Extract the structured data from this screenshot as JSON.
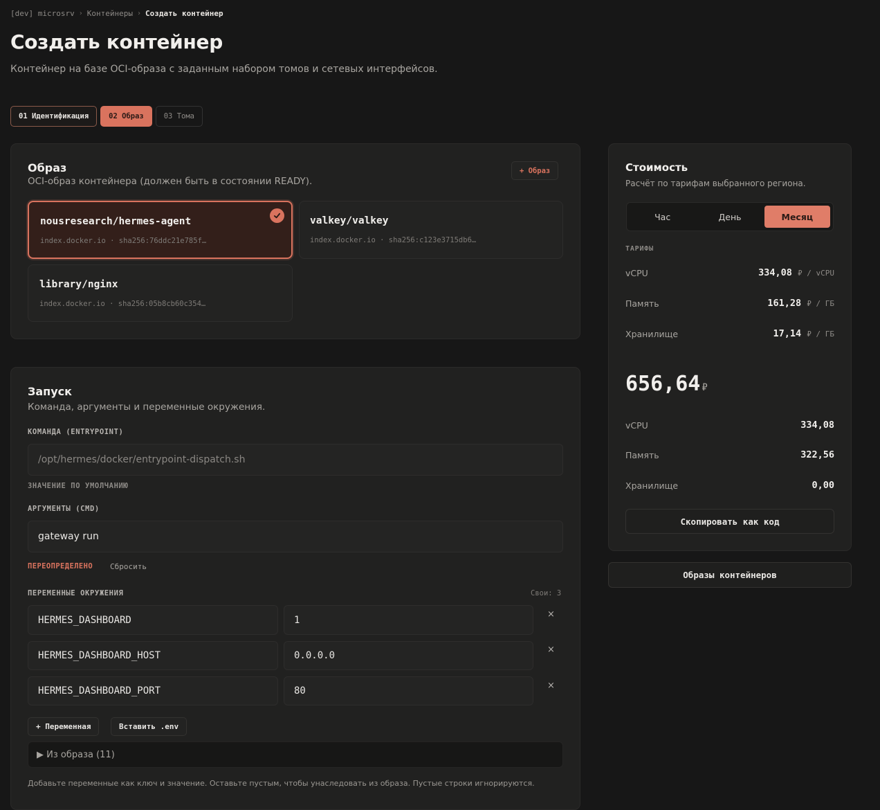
{
  "breadcrumb": {
    "project": "[dev] microsrv",
    "section": "Контейнеры",
    "current": "Создать контейнер"
  },
  "page": {
    "title": "Создать контейнер",
    "subtitle": "Контейнер на базе OCI-образа с заданным набором томов и сетевых интерфейсов."
  },
  "steps": [
    {
      "label": "01 Идентификация",
      "state": "done"
    },
    {
      "label": "02 Образ",
      "state": "active"
    },
    {
      "label": "03 Тома",
      "state": "pending"
    }
  ],
  "image_card": {
    "title": "Образ",
    "subtitle": "OCI-образ контейнера (должен быть в состоянии READY).",
    "add_button": "+ Образ",
    "images": [
      {
        "name": "nousresearch/hermes-agent",
        "meta": "index.docker.io · sha256:76ddc21e785f…",
        "selected": true
      },
      {
        "name": "valkey/valkey",
        "meta": "index.docker.io · sha256:c123e3715db6…",
        "selected": false
      },
      {
        "name": "library/nginx",
        "meta": "index.docker.io · sha256:05b8cb60c354…",
        "selected": false
      }
    ]
  },
  "launch_card": {
    "title": "Запуск",
    "subtitle": "Команда, аргументы и переменные окружения.",
    "entrypoint_label": "КОМАНДА (ENTRYPOINT)",
    "entrypoint_placeholder": "/opt/hermes/docker/entrypoint-dispatch.sh",
    "entrypoint_status": "ЗНАЧЕНИЕ ПО УМОЛЧАНИЮ",
    "cmd_label": "АРГУМЕНТЫ (CMD)",
    "cmd_value": "gateway run",
    "cmd_status": "ПЕРЕОПРЕДЕЛЕНО",
    "reset_label": "Сбросить",
    "env_label": "ПЕРЕМЕННЫЕ ОКРУЖЕНИЯ",
    "env_count": "Свои: 3",
    "env": [
      {
        "key": "HERMES_DASHBOARD",
        "value": "1"
      },
      {
        "key": "HERMES_DASHBOARD_HOST",
        "value": "0.0.0.0"
      },
      {
        "key": "HERMES_DASHBOARD_PORT",
        "value": "80"
      }
    ],
    "remove_glyph": "×",
    "add_var_button": "+ Переменная",
    "paste_env_button": "Вставить .env",
    "from_image": "▶ Из образа (11)",
    "hint": "Добавьте переменные как ключ и значение. Оставьте пустым, чтобы унаследовать из образа. Пустые строки игнорируются."
  },
  "cost": {
    "title": "Стоимость",
    "subtitle": "Расчёт по тарифам выбранного региона.",
    "periods": [
      "Час",
      "День",
      "Месяц"
    ],
    "selected_period": "Месяц",
    "rates_caption": "ТАРИФЫ",
    "rates": [
      {
        "label": "vCPU",
        "value": "334,08",
        "unit": "₽ / vCPU"
      },
      {
        "label": "Память",
        "value": "161,28",
        "unit": "₽ / ГБ"
      },
      {
        "label": "Хранилище",
        "value": "17,14",
        "unit": "₽ / ГБ"
      }
    ],
    "total": "656,64",
    "currency": "₽",
    "breakdown": [
      {
        "label": "vCPU",
        "value": "334,08"
      },
      {
        "label": "Память",
        "value": "322,56"
      },
      {
        "label": "Хранилище",
        "value": "0,00"
      }
    ],
    "copy_button": "Скопировать как код"
  },
  "images_link_button": "Образы контейнеров",
  "colors": {
    "accent": "#d9735e",
    "background": "#171717",
    "card": "#212120"
  }
}
